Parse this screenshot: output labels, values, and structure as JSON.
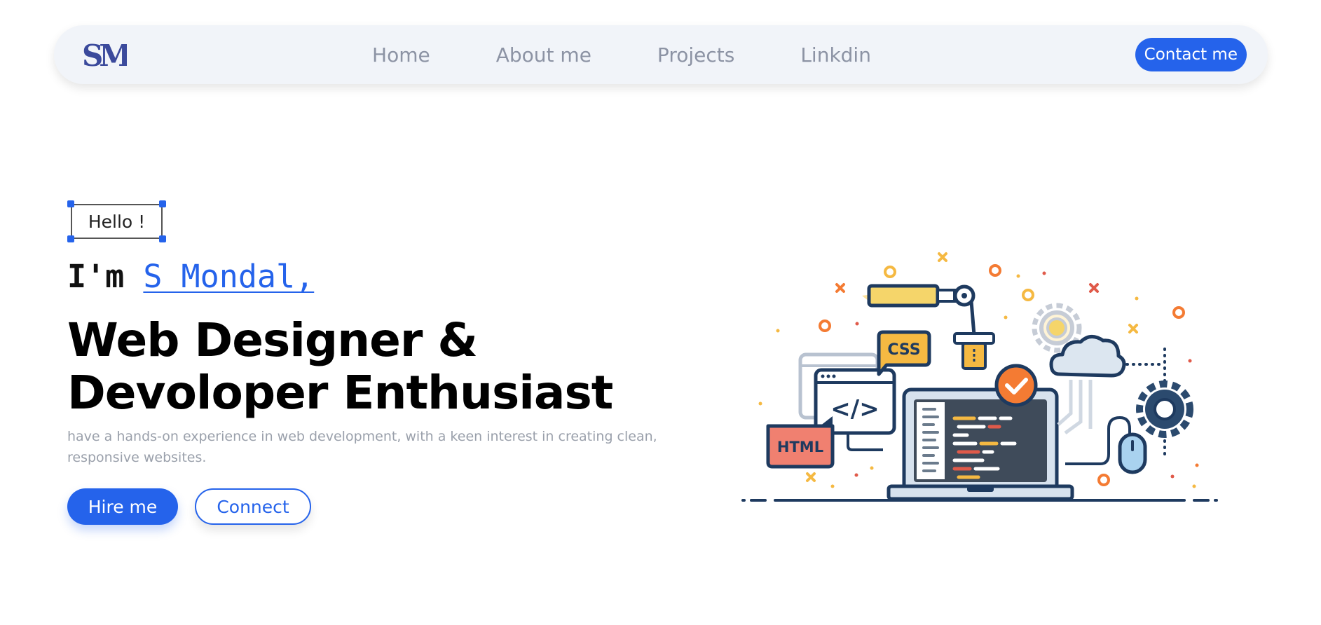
{
  "brand": {
    "logo_text": "SM",
    "logo_color": "#3b4a9c"
  },
  "nav": {
    "links": [
      {
        "label": "Home"
      },
      {
        "label": "About me"
      },
      {
        "label": "Projects"
      },
      {
        "label": "Linkdin"
      }
    ],
    "contact_label": "Contact me"
  },
  "hero": {
    "greeting": "Hello !",
    "intro_prefix": "I'm ",
    "name": "S Mondal,",
    "headline_line1": "Web Designer &",
    "headline_line2": "Devoloper Enthusiast",
    "description": "have a hands-on experience in web development, with a keen interest in creating clean, responsive websites.",
    "hire_label": "Hire me",
    "connect_label": "Connect"
  },
  "illustration": {
    "css_tag": "CSS",
    "html_tag": "HTML",
    "code_glyph": "</>"
  },
  "colors": {
    "accent": "#2563eb",
    "nav_bg": "#f1f4f9",
    "nav_text": "#8c93a4",
    "muted_text": "#9aa0ab",
    "dark_outline": "#1e3a5f",
    "orange": "#f47b33",
    "yellow": "#f5b942",
    "salmon": "#f08070"
  }
}
